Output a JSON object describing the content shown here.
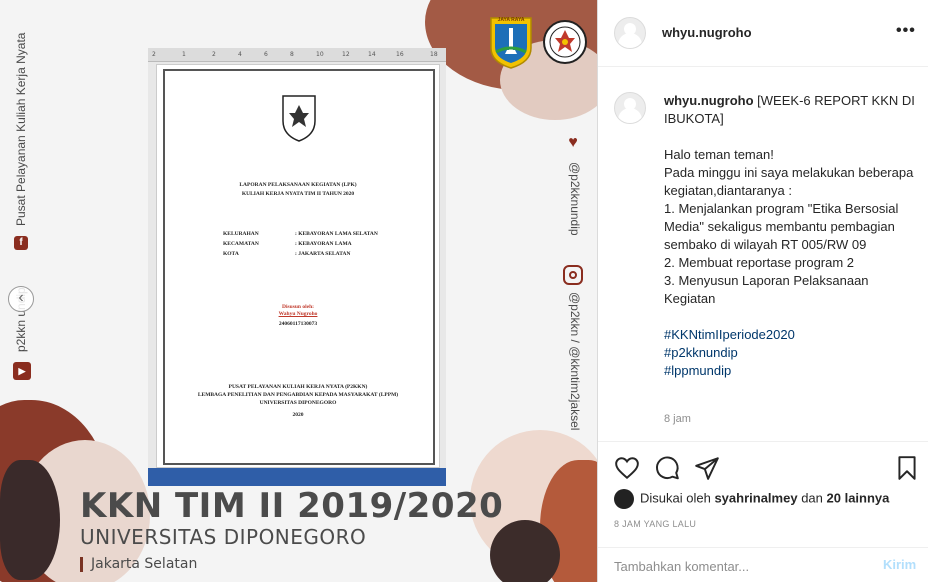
{
  "media": {
    "left_vertical_text": "Pusat Pelayanan Kuliah Kerja Nyata",
    "left_vertical_handle": "p2kkn undip",
    "right_vertical_handle_1": "@p2kknundip",
    "right_vertical_handle_2": "@p2kkn / @kkntim2jaksel",
    "document": {
      "ruler_ticks": [
        "2",
        "1",
        "2",
        "4",
        "6",
        "8",
        "10",
        "12",
        "14",
        "16",
        "18"
      ],
      "report_title_1": "LAPORAN PELAKSANAAN KEGIATAN (LPK)",
      "report_title_2": "KULIAH KERJA NYATA TIM II TAHUN 2020",
      "rows": [
        {
          "label": "KELURAHAN",
          "value": ": KEBAYORAN LAMA SELATAN"
        },
        {
          "label": "KECAMATAN",
          "value": ": KEBAYORAN LAMA"
        },
        {
          "label": "KOTA",
          "value": ": JAKARTA SELATAN"
        }
      ],
      "disusun": "Disusun oleh:",
      "author": "Wahyu Nugroho",
      "nim": "24060117130073",
      "footer_1": "PUSAT PELAYANAN KULIAH KERJA NYATA (P2KKN)",
      "footer_2": "LEMBAGA PENELITIAN DAN PENGABDIAN KEPADA MASYARAKAT (LPPM)",
      "footer_3": "UNIVERSITAS DIPONEGORO",
      "footer_4": "2020"
    },
    "banner_title": "KKN TIM II 2019/2020",
    "banner_subtitle": "UNIVERSITAS DIPONEGORO",
    "banner_location": "Jakarta Selatan",
    "logo_left_text": "JAYA RAYA"
  },
  "post": {
    "username": "whyu.nugroho",
    "caption_title": "[WEEK-6 REPORT KKN DI IBUKOTA]",
    "caption_lines": [
      "Halo teman teman!",
      "Pada minggu ini saya melakukan beberapa kegiatan,diantaranya :",
      "1. Menjalankan program \"Etika Bersosial Media\" sekaligus membantu pembagian sembako di wilayah RT 005/RW 09",
      "2. Membuat reportase program 2",
      "3. Menyusun Laporan Pelaksanaan Kegiatan"
    ],
    "hashtags": [
      "#KKNtimIIperiode2020",
      "#p2kknundip",
      "#lppmundip"
    ],
    "caption_time": "8 jam",
    "likes_prefix": "Disukai oleh",
    "likes_user": "syahrinalmey",
    "likes_and": "dan",
    "likes_others": "20 lainnya",
    "time_ago": "8 JAM YANG LALU",
    "comment_placeholder": "Tambahkan komentar...",
    "post_button": "Kirim"
  },
  "colors": {
    "brown": "#8a2d1f",
    "link": "#00376b",
    "post_button": "#b2dffc"
  }
}
